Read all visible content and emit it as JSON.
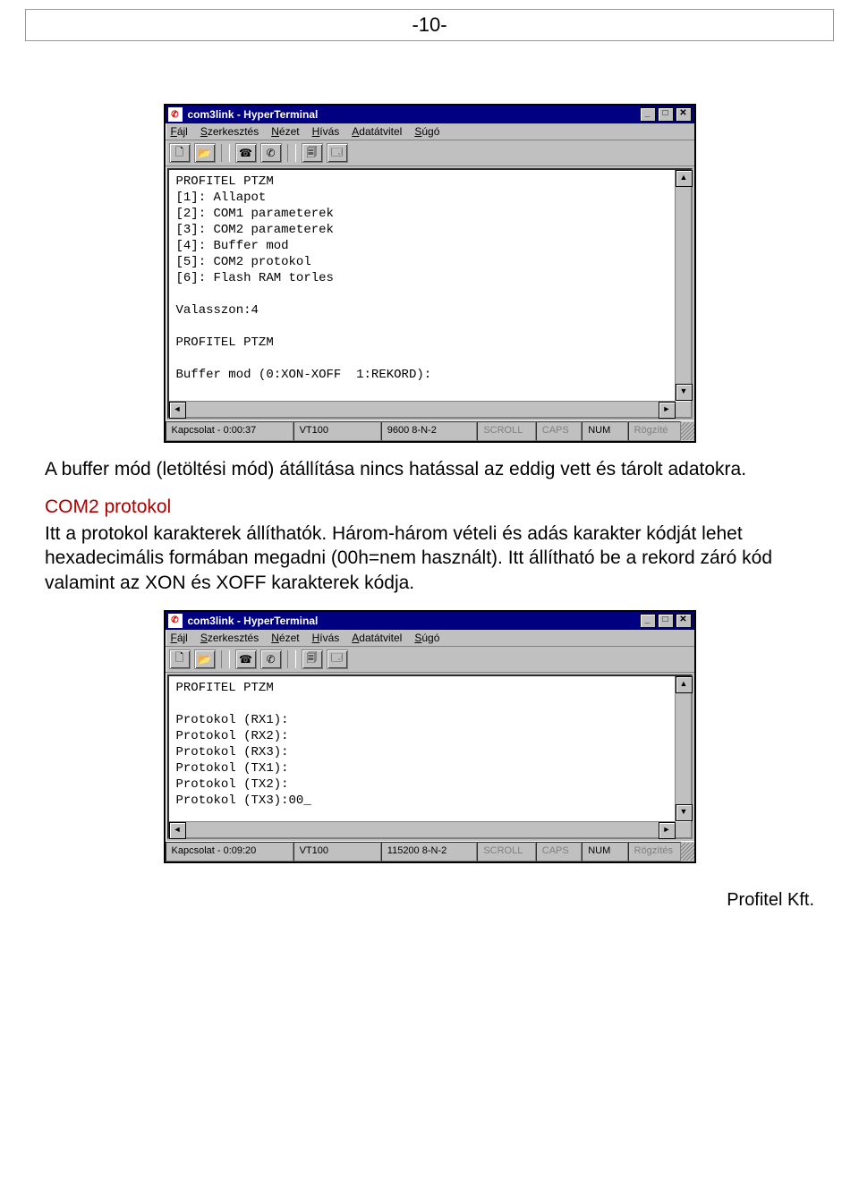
{
  "page_number_label": "-10-",
  "screenshot1": {
    "title": "com3link - HyperTerminal",
    "menu": [
      "Fájl",
      "Szerkesztés",
      "Nézet",
      "Hívás",
      "Adatátvitel",
      "Súgó"
    ],
    "terminal": "PROFITEL PTZM\n[1]: Allapot\n[2]: COM1 parameterek\n[3]: COM2 parameterek\n[4]: Buffer mod\n[5]: COM2 protokol\n[6]: Flash RAM torles\n\nValasszon:4\n\nPROFITEL PTZM\n\nBuffer mod (0:XON-XOFF  1:REKORD):",
    "status": {
      "conn": "Kapcsolat - 0:00:37",
      "emul": "VT100",
      "line": "9600 8-N-2",
      "scroll": "SCROLL",
      "caps": "CAPS",
      "num": "NUM",
      "rec": "Rögzíté"
    }
  },
  "para1": "A buffer mód (letöltési mód) átállítása nincs hatással az eddig vett és tárolt adatokra.",
  "heading": "COM2 protokol",
  "para2": "Itt a protokol karakterek állíthatók. Három-három vételi és adás karakter kódját lehet hexadecimális formában megadni (00h=nem használt). Itt állítható be a rekord záró kód valamint az XON és XOFF karakterek kódja.",
  "screenshot2": {
    "title": "com3link - HyperTerminal",
    "menu": [
      "Fájl",
      "Szerkesztés",
      "Nézet",
      "Hívás",
      "Adatátvitel",
      "Súgó"
    ],
    "terminal": "PROFITEL PTZM\n\nProtokol (RX1):\nProtokol (RX2):\nProtokol (RX3):\nProtokol (TX1):\nProtokol (TX2):\nProtokol (TX3):00_",
    "status": {
      "conn": "Kapcsolat - 0:09:20",
      "emul": "VT100",
      "line": "115200 8-N-2",
      "scroll": "SCROLL",
      "caps": "CAPS",
      "num": "NUM",
      "rec": "Rögzítés"
    }
  },
  "footer": "Profitel Kft."
}
